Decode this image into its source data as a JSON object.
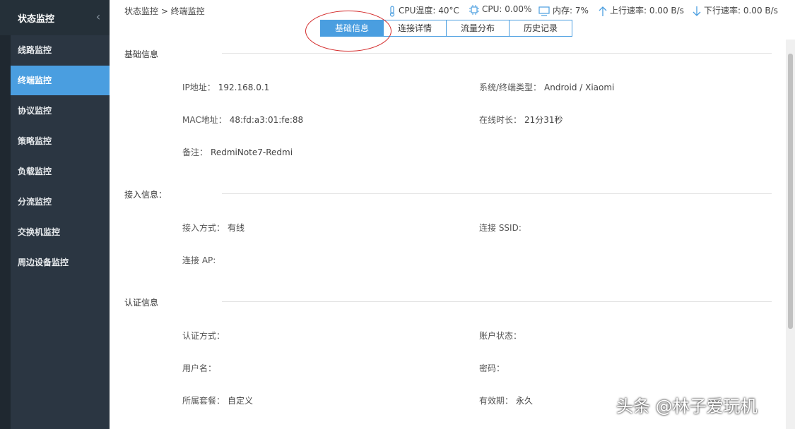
{
  "sidebar": {
    "title": "状态监控",
    "collapse_icon": "chevron-left-icon",
    "items": [
      {
        "label": "线路监控"
      },
      {
        "label": "终端监控"
      },
      {
        "label": "协议监控"
      },
      {
        "label": "策略监控"
      },
      {
        "label": "负载监控"
      },
      {
        "label": "分流监控"
      },
      {
        "label": "交换机监控"
      },
      {
        "label": "周边设备监控"
      }
    ],
    "active_index": 1
  },
  "header": {
    "breadcrumb": "状态监控 > 终端监控",
    "cpu_temp": "CPU温度: 40°C",
    "cpu": "CPU: 0.00%",
    "memory": "内存: 7%",
    "upload": "上行速率: 0.00 B/s",
    "download": "下行速率: 0.00 B/s"
  },
  "tabs": [
    {
      "label": "基础信息",
      "active": true
    },
    {
      "label": "连接详情",
      "active": false
    },
    {
      "label": "流量分布",
      "active": false
    },
    {
      "label": "历史记录",
      "active": false
    }
  ],
  "basic": {
    "title": "基础信息",
    "ip_label": "IP地址：",
    "ip_value": "192.168.0.1",
    "os_label": "系统/终端类型：",
    "os_value": "Android / Xiaomi",
    "mac_label": "MAC地址：",
    "mac_value": "48:fd:a3:01:fe:88",
    "uptime_label": "在线时长：",
    "uptime_value": "21分31秒",
    "note_label": "备注：",
    "note_value": "RedmiNote7-Redmi"
  },
  "access": {
    "title": "接入信息：",
    "method_label": "接入方式：",
    "method_value": "有线",
    "ssid_label": "连接 SSID:",
    "ap_label": "连接 AP:"
  },
  "auth": {
    "title": "认证信息",
    "method_label": "认证方式：",
    "account_status_label": "账户状态：",
    "username_label": "用户名：",
    "password_label": "密码：",
    "package_label": "所属套餐：",
    "package_value": "自定义",
    "validity_label": "有效期：",
    "validity_value": "永久"
  },
  "watermark": "头条 @林子爱玩机",
  "colors": {
    "sidebar_bg": "#2b3642",
    "accent": "#4a9ee0",
    "annotation_red": "#d42b2b"
  }
}
